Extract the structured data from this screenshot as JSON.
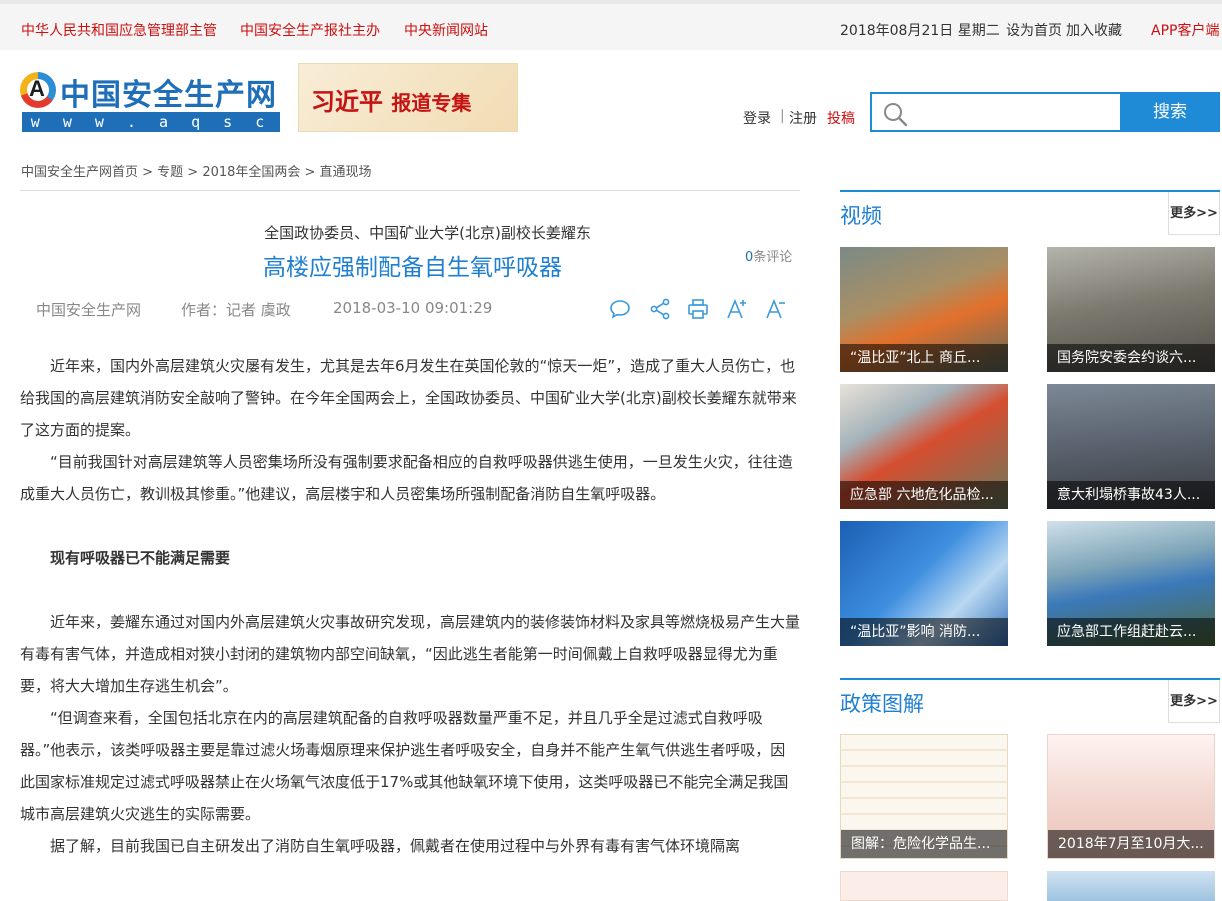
{
  "topbar": {
    "left_links": [
      "中华人民共和国应急管理部主管",
      "中国安全生产报社主办",
      "中央新闻网站"
    ],
    "date": "2018年08月21日 星期二",
    "set_home": "设为首页",
    "favorite": "加入收藏",
    "app": "APP客户端"
  },
  "header": {
    "logo_name": "中国安全生产网",
    "logo_url": "w w w . a q s c . c n",
    "logo_letter": "A",
    "banner_main": "习近平",
    "banner_sub": "报道专集",
    "login": "登录",
    "sep": "|",
    "register": "注册",
    "submit": "投稿",
    "search_placeholder": "",
    "search_button": "搜索"
  },
  "breadcrumb": "中国安全生产网首页 > 专题 > 2018年全国两会 > 直通现场",
  "article": {
    "subtitle": "全国政协委员、中国矿业大学(北京)副校长姜耀东",
    "title": "高楼应强制配备自生氧呼吸器",
    "comment_count": "0",
    "comment_label": "条评论",
    "source": "中国安全生产网",
    "author": "作者：记者 虞政",
    "datetime": "2018-03-10 09:01:29",
    "paragraphs": [
      "近年来，国内外高层建筑火灾屡有发生，尤其是去年6月发生在英国伦敦的“惊天一炬”，造成了重大人员伤亡，也给我国的高层建筑消防安全敲响了警钟。在今年全国两会上，全国政协委员、中国矿业大学(北京)副校长姜耀东就带来了这方面的提案。",
      "“目前我国针对高层建筑等人员密集场所没有强制要求配备相应的自救呼吸器供逃生使用，一旦发生火灾，往往造成重大人员伤亡，教训极其惨重。”他建议，高层楼宇和人员密集场所强制配备消防自生氧呼吸器。",
      "",
      "现有呼吸器已不能满足需要",
      "",
      "近年来，姜耀东通过对国内外高层建筑火灾事故研究发现，高层建筑内的装修装饰材料及家具等燃烧极易产生大量有毒有害气体，并造成相对狭小封闭的建筑物内部空间缺氧，“因此逃生者能第一时间佩戴上自救呼吸器显得尤为重要，将大大增加生存逃生机会”。",
      "“但调查来看，全国包括北京在内的高层建筑配备的自救呼吸器数量严重不足，并且几乎全是过滤式自救呼吸器。”他表示，该类呼吸器主要是靠过滤火场毒烟原理来保护逃生者呼吸安全，自身并不能产生氧气供逃生者呼吸，因此国家标准规定过滤式呼吸器禁止在火场氧气浓度低于17%或其他缺氧环境下使用，这类呼吸器已不能完全满足我国城市高层建筑火灾逃生的实际需要。",
      "据了解，目前我国已自主研发出了消防自生氧呼吸器，佩戴者在使用过程中与外界有毒有害气体环境隔离"
    ]
  },
  "sidebar": {
    "video": {
      "label": "视频",
      "more": "更多>>",
      "items": [
        "“温比亚”北上 商丘...",
        "国务院安委会约谈六...",
        "应急部 六地危化品检...",
        "意大利塌桥事故43人...",
        "“温比亚”影响 消防...",
        "应急部工作组赶赴云..."
      ]
    },
    "policy": {
      "label": "政策图解",
      "more": "更多>>",
      "items": [
        "图解：危险化学品生...",
        "2018年7月至10月大..."
      ]
    }
  },
  "colors": {
    "accent": "#1f8ad6",
    "red": "#cc1010",
    "title": "#1f7fd0"
  }
}
